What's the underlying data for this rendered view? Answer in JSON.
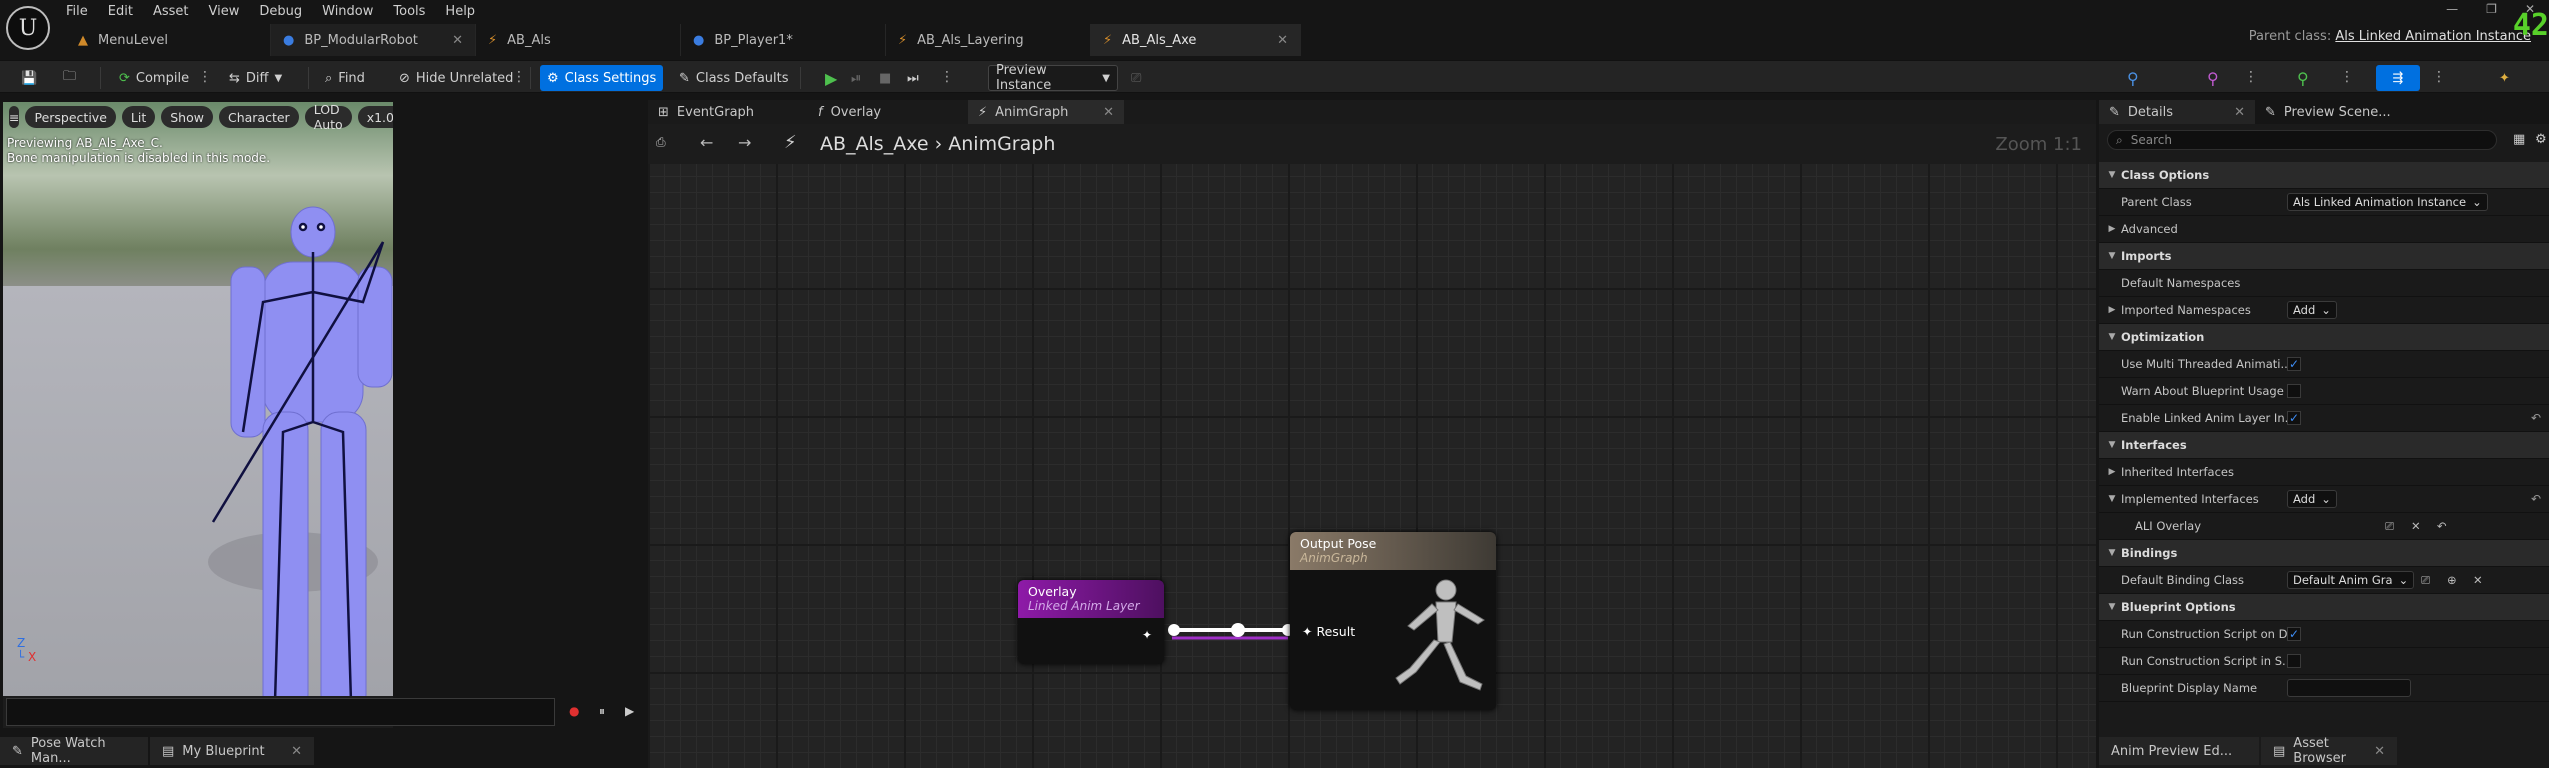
{
  "menu": [
    "File",
    "Edit",
    "Asset",
    "View",
    "Debug",
    "Window",
    "Tools",
    "Help"
  ],
  "doc_tabs": [
    {
      "label": "MenuLevel",
      "icon": "level-icon"
    },
    {
      "label": "BP_ModularRobot",
      "icon": "person-icon"
    },
    {
      "label": "AB_Als",
      "icon": "anim-icon"
    },
    {
      "label": "BP_Player1*",
      "icon": "person-icon"
    },
    {
      "label": "AB_Als_Layering",
      "icon": "anim-icon"
    },
    {
      "label": "AB_Als_Axe",
      "icon": "anim-icon"
    }
  ],
  "parent_class": {
    "prefix": "Parent class:",
    "value": "Als Linked Animation Instance"
  },
  "fps": "42",
  "toolbar": {
    "compile": "Compile",
    "diff": "Diff",
    "find": "Find",
    "hide_unrelated": "Hide Unrelated",
    "class_settings": "Class Settings",
    "class_defaults": "Class Defaults",
    "preview_instance": "Preview Instance"
  },
  "viewport": {
    "perspective": "Perspective",
    "lit": "Lit",
    "show": "Show",
    "character": "Character",
    "lod": "LOD Auto",
    "speed": "x1.0",
    "line1": "Previewing AB_Als_Axe_C.",
    "line2": "Bone manipulation is disabled in this mode."
  },
  "bottom_left_tabs": [
    "Pose Watch Man...",
    "My Blueprint"
  ],
  "graph_tabs": [
    "EventGraph",
    "Overlay",
    "AnimGraph"
  ],
  "breadcrumb": {
    "root": "AB_Als_Axe",
    "leaf": "AnimGraph",
    "zoom": "Zoom 1:1"
  },
  "nodes": {
    "overlay": {
      "title": "Overlay",
      "subtitle": "Linked Anim Layer"
    },
    "output": {
      "title": "Output Pose",
      "subtitle": "AnimGraph",
      "pin": "Result"
    }
  },
  "details_tabs": [
    "Details",
    "Preview Scene..."
  ],
  "search_placeholder": "Search",
  "details": [
    {
      "type": "cat",
      "label": "Class Options"
    },
    {
      "type": "prop",
      "label": "Parent Class",
      "dropdown": "Als Linked Animation Instance"
    },
    {
      "type": "sub",
      "label": "Advanced"
    },
    {
      "type": "cat",
      "label": "Imports"
    },
    {
      "type": "prop",
      "label": "Default Namespaces"
    },
    {
      "type": "sub",
      "label": "Imported Namespaces",
      "dropdown": "Add"
    },
    {
      "type": "cat",
      "label": "Optimization"
    },
    {
      "type": "prop",
      "label": "Use Multi Threaded Animati...",
      "check": true
    },
    {
      "type": "prop",
      "label": "Warn About Blueprint Usage",
      "check": false
    },
    {
      "type": "prop",
      "label": "Enable Linked Anim Layer In...",
      "check": true,
      "reset": true
    },
    {
      "type": "cat",
      "label": "Interfaces"
    },
    {
      "type": "sub",
      "label": "Inherited Interfaces"
    },
    {
      "type": "subopen",
      "label": "Implemented Interfaces",
      "dropdown": "Add",
      "reset": true
    },
    {
      "type": "iface",
      "label": "ALI Overlay"
    },
    {
      "type": "cat",
      "label": "Bindings"
    },
    {
      "type": "prop",
      "label": "Default Binding Class",
      "dropdown": "Default Anim Gra"
    },
    {
      "type": "cat",
      "label": "Blueprint Options"
    },
    {
      "type": "prop",
      "label": "Run Construction Script on D...",
      "check": true
    },
    {
      "type": "prop",
      "label": "Run Construction Script in S...",
      "check": false
    },
    {
      "type": "prop",
      "label": "Blueprint Display Name",
      "text": ""
    }
  ],
  "bottom_right_tabs": [
    "Anim Preview Ed...",
    "Asset Browser"
  ]
}
